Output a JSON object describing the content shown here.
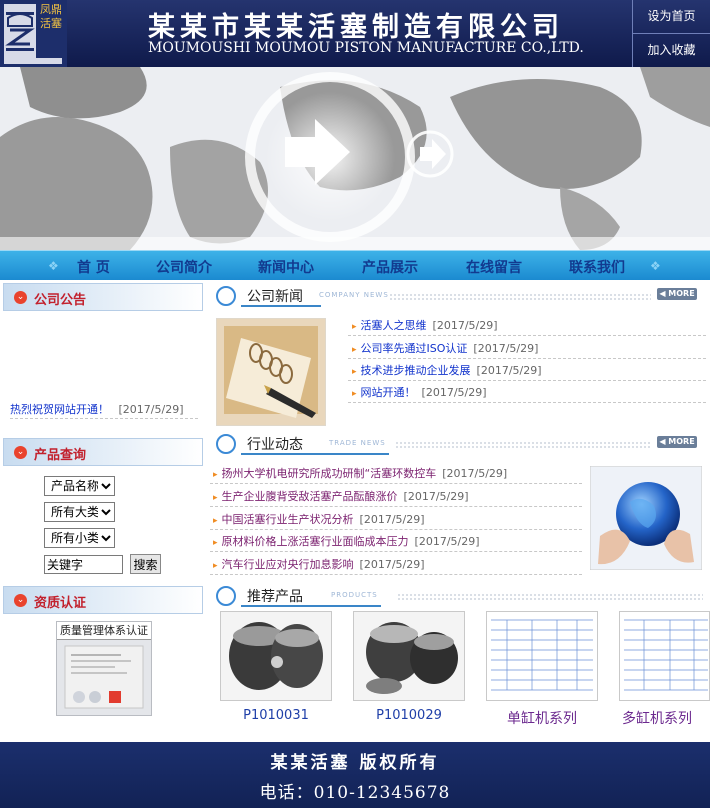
{
  "header": {
    "logo_text": "凤鼎活塞",
    "company_cn": "某某市某某活塞制造有限公司",
    "company_en": "MOUMOUSHI MOUMOU PISTON MANUFACTURE CO.,LTD.",
    "links": [
      "设为首页",
      "加入收藏"
    ]
  },
  "nav": {
    "items": [
      "首 页",
      "公司简介",
      "新闻中心",
      "产品展示",
      "在线留言",
      "联系我们"
    ]
  },
  "sidebar": {
    "notice": {
      "title": "公司公告",
      "items": [
        {
          "text": "热烈祝贺网站开通！",
          "date": "[2017/5/29]"
        }
      ]
    },
    "search": {
      "title": "产品查询",
      "select_product": "产品名称",
      "select_major": "所有大类",
      "select_minor": "所有小类",
      "keyword_value": "关键字",
      "button": "搜索"
    },
    "cert": {
      "title": "资质认证",
      "image_caption": "质量管理体系认证"
    }
  },
  "company_news": {
    "title": "公司新闻",
    "subtitle": "COMPANY NEWS",
    "more": "MORE",
    "items": [
      {
        "text": "活塞人之思维",
        "date": "[2017/5/29]"
      },
      {
        "text": "公司率先通过ISO认证",
        "date": "[2017/5/29]"
      },
      {
        "text": "技术进步推动企业发展",
        "date": "[2017/5/29]"
      },
      {
        "text": "网站开通！",
        "date": "[2017/5/29]"
      }
    ]
  },
  "industry_news": {
    "title": "行业动态",
    "subtitle": "TRADE NEWS",
    "more": "MORE",
    "items": [
      {
        "text": "扬州大学机电研究所成功研制“活塞环数控车",
        "date": "[2017/5/29]"
      },
      {
        "text": "生产企业腹背受敌活塞产品酝酿涨价",
        "date": "[2017/5/29]"
      },
      {
        "text": "中国活塞行业生产状况分析",
        "date": "[2017/5/29]"
      },
      {
        "text": "原材料价格上涨活塞行业面临成本压力",
        "date": "[2017/5/29]"
      },
      {
        "text": "汽车行业应对央行加息影响",
        "date": "[2017/5/29]"
      }
    ]
  },
  "products": {
    "title": "推荐产品",
    "subtitle": "PRODUCTS",
    "items": [
      {
        "label": "P1010031"
      },
      {
        "label": "P1010029"
      },
      {
        "label": "单缸机系列"
      },
      {
        "label": "多缸机系列"
      }
    ]
  },
  "footer": {
    "copyright": "某某活塞 版权所有",
    "phone": "电话：010-12345678"
  },
  "colors": {
    "header_bg": "#1b2b68",
    "nav_bg": "#2aa0e0",
    "nav_text": "#123a8f",
    "section_title_red": "#c2212d",
    "news_link": "#1133cc",
    "industry_link": "#7a1f6e",
    "product_label_blue": "#1f3fa8",
    "product_label_purple": "#6c2a8f"
  }
}
